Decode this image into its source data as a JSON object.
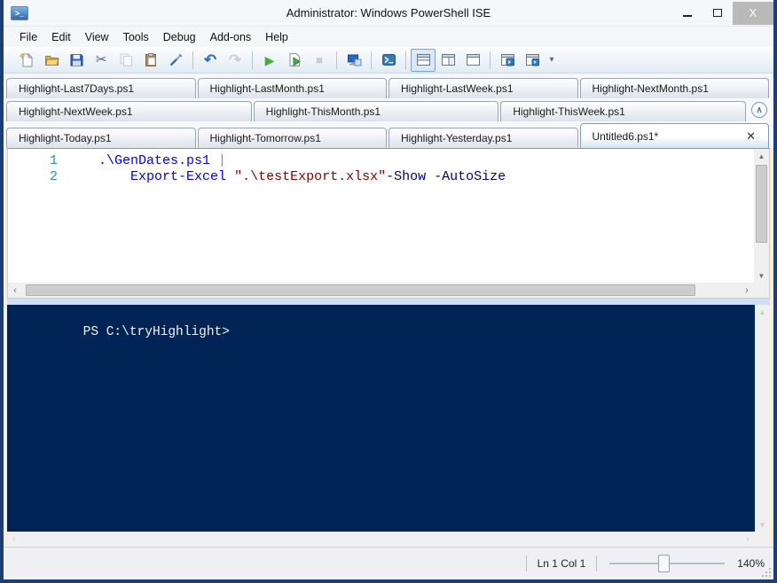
{
  "window": {
    "title": "Administrator: Windows PowerShell ISE",
    "controls": {
      "minimize": "",
      "maximize": "",
      "close": "X"
    }
  },
  "menu": {
    "items": [
      "File",
      "Edit",
      "View",
      "Tools",
      "Debug",
      "Add-ons",
      "Help"
    ]
  },
  "toolbar": {
    "items": [
      {
        "name": "new-script"
      },
      {
        "name": "open-script"
      },
      {
        "name": "save-script"
      },
      {
        "name": "cut"
      },
      {
        "name": "copy",
        "disabled": true
      },
      {
        "name": "paste"
      },
      {
        "name": "clear-console-pane"
      },
      {
        "sep": true
      },
      {
        "name": "undo"
      },
      {
        "name": "redo",
        "disabled": true
      },
      {
        "sep": true
      },
      {
        "name": "run-script"
      },
      {
        "name": "run-selection"
      },
      {
        "name": "stop-operation",
        "disabled": true
      },
      {
        "sep": true
      },
      {
        "name": "new-remote-powershell-tab"
      },
      {
        "sep": true
      },
      {
        "name": "start-powershell-exe"
      },
      {
        "sep": true
      },
      {
        "name": "show-script-pane-top",
        "selected": true
      },
      {
        "name": "show-script-pane-right"
      },
      {
        "name": "show-script-pane-maximized"
      },
      {
        "sep": true
      },
      {
        "name": "new-powershell-tab"
      },
      {
        "name": "powershell-tab-window"
      },
      {
        "name": "toolbar-overflow"
      }
    ]
  },
  "tabs": {
    "rows": [
      [
        "Highlight-Last7Days.ps1",
        "Highlight-LastMonth.ps1",
        "Highlight-LastWeek.ps1",
        "Highlight-NextMonth.ps1"
      ],
      [
        "Highlight-NextWeek.ps1",
        "Highlight-ThisMonth.ps1",
        "Highlight-ThisWeek.ps1"
      ],
      [
        "Highlight-Today.ps1",
        "Highlight-Tomorrow.ps1",
        "Highlight-Yesterday.ps1",
        "Untitled6.ps1*"
      ]
    ],
    "active": "Untitled6.ps1*",
    "close_glyph": "✕",
    "scroll_up_glyph": "∧"
  },
  "editor": {
    "lines": [
      {
        "number": "1",
        "segments": [
          {
            "type": "command",
            "text": ".\\GenDates.ps1"
          },
          {
            "type": "plain",
            "text": " "
          },
          {
            "type": "operator",
            "text": "|"
          }
        ]
      },
      {
        "number": "2",
        "segments": [
          {
            "type": "plain",
            "text": "    "
          },
          {
            "type": "command",
            "text": "Export-Excel"
          },
          {
            "type": "plain",
            "text": " "
          },
          {
            "type": "string",
            "text": "\".\\testExport.xlsx\""
          },
          {
            "type": "parameter",
            "text": "-Show"
          },
          {
            "type": "plain",
            "text": " "
          },
          {
            "type": "parameter",
            "text": "-AutoSize"
          }
        ]
      }
    ],
    "colors": {
      "command": "#0000ff",
      "string": "#8b0000",
      "parameter": "#000080",
      "operator": "#8888aa",
      "plain": "#000000",
      "line_number": "#2b91af"
    }
  },
  "console": {
    "prompt": "PS C:\\tryHighlight>",
    "background": "#012456"
  },
  "statusbar": {
    "position": "Ln 1 Col 1",
    "zoom_level": "140%"
  }
}
